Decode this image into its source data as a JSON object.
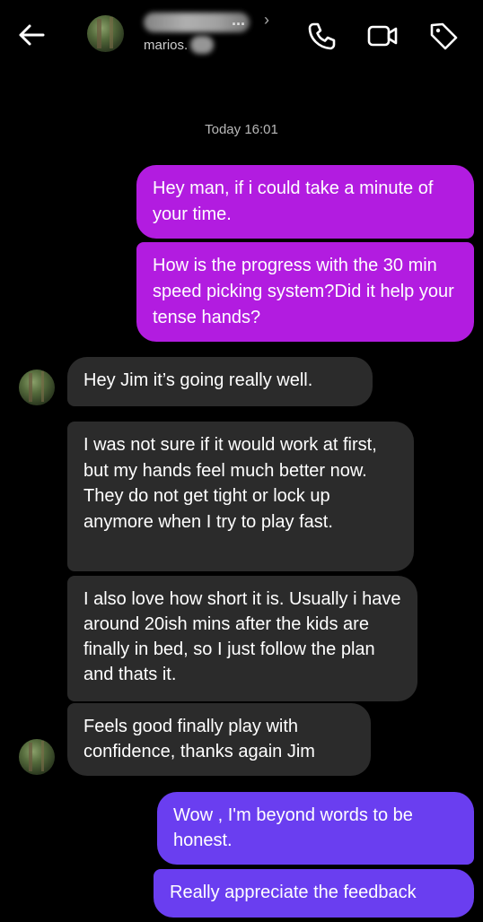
{
  "header": {
    "username": "marios.",
    "name_dots": "...",
    "name_chevron": "›",
    "icons": [
      "back-arrow-icon",
      "phone-icon",
      "video-camera-icon",
      "tag-icon"
    ]
  },
  "thread": {
    "timestamp": "Today 16:01",
    "messages": [
      {
        "from": "me",
        "text": "Hey man, if i could take a minute of your time."
      },
      {
        "from": "me",
        "text": "How is the progress with the 30 min speed picking system?Did it help your tense hands?"
      },
      {
        "from": "them",
        "text": "Hey Jim it’s  going really well."
      },
      {
        "from": "them",
        "text": "I was not sure if it would work at first, but my hands feel much better now. They do not get tight or lock up anymore when I try to play fast."
      },
      {
        "from": "them",
        "text": "I also love how short it is. Usually i have around 20ish mins after the kids are finally in bed, so I just follow the plan and thats it."
      },
      {
        "from": "them",
        "text": "Feels good finally play with confidence, thanks again Jim"
      },
      {
        "from": "me",
        "text": "Wow , I'm beyond words to be honest."
      },
      {
        "from": "me",
        "text": "Really appreciate the feedback"
      }
    ]
  },
  "colors": {
    "background": "#000000",
    "outgoing_purple": "#b21ce0",
    "outgoing_violet": "#6a3ef0",
    "incoming": "#2b2b2b"
  }
}
